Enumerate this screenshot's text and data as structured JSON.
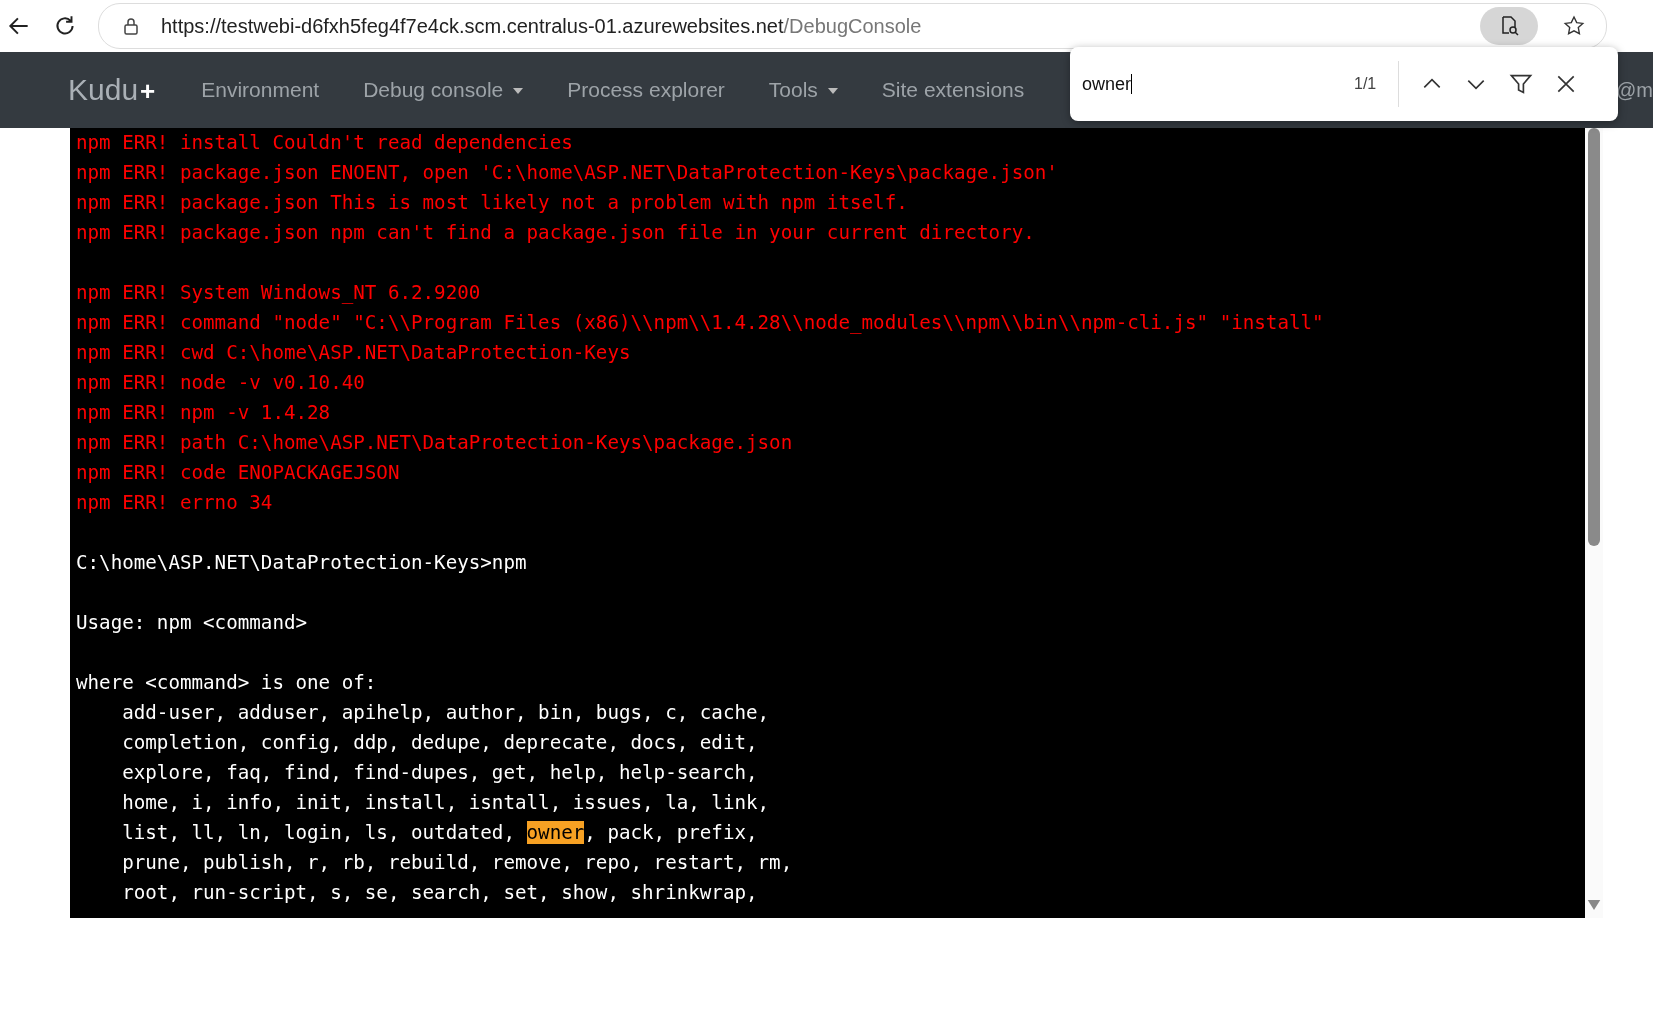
{
  "browser": {
    "url_host": "https://testwebi-d6fxh5feg4f7e4ck.scm.centralus-01.azurewebsites.net",
    "url_path": "/DebugConsole"
  },
  "navbar": {
    "logo": "Kudu",
    "logo_plus": "+",
    "items": [
      {
        "label": "Environment",
        "dropdown": false
      },
      {
        "label": "Debug console",
        "dropdown": true
      },
      {
        "label": "Process explorer",
        "dropdown": false
      },
      {
        "label": "Tools",
        "dropdown": true
      },
      {
        "label": "Site extensions",
        "dropdown": false
      }
    ],
    "user": "@m"
  },
  "find_bar": {
    "value": "owner",
    "count": "1/1"
  },
  "console": {
    "lines": [
      {
        "kind": "error",
        "text": "npm ERR! install Couldn't read dependencies"
      },
      {
        "kind": "error",
        "text": "npm ERR! package.json ENOENT, open 'C:\\home\\ASP.NET\\DataProtection-Keys\\package.json'"
      },
      {
        "kind": "error",
        "text": "npm ERR! package.json This is most likely not a problem with npm itself."
      },
      {
        "kind": "error",
        "text": "npm ERR! package.json npm can't find a package.json file in your current directory."
      },
      {
        "kind": "blank"
      },
      {
        "kind": "error",
        "text": "npm ERR! System Windows_NT 6.2.9200"
      },
      {
        "kind": "error",
        "text": "npm ERR! command \"node\" \"C:\\\\Program Files (x86)\\\\npm\\\\1.4.28\\\\node_modules\\\\npm\\\\bin\\\\npm-cli.js\" \"install\""
      },
      {
        "kind": "error",
        "text": "npm ERR! cwd C:\\home\\ASP.NET\\DataProtection-Keys"
      },
      {
        "kind": "error",
        "text": "npm ERR! node -v v0.10.40"
      },
      {
        "kind": "error",
        "text": "npm ERR! npm -v 1.4.28"
      },
      {
        "kind": "error",
        "text": "npm ERR! path C:\\home\\ASP.NET\\DataProtection-Keys\\package.json"
      },
      {
        "kind": "error",
        "text": "npm ERR! code ENOPACKAGEJSON"
      },
      {
        "kind": "error",
        "text": "npm ERR! errno 34"
      },
      {
        "kind": "blank"
      },
      {
        "kind": "output",
        "text": "C:\\home\\ASP.NET\\DataProtection-Keys>npm"
      },
      {
        "kind": "blank"
      },
      {
        "kind": "output",
        "text": "Usage: npm <command>"
      },
      {
        "kind": "blank"
      },
      {
        "kind": "output",
        "text": "where <command> is one of:"
      },
      {
        "kind": "output",
        "text": "    add-user, adduser, apihelp, author, bin, bugs, c, cache,"
      },
      {
        "kind": "output",
        "text": "    completion, config, ddp, dedupe, deprecate, docs, edit,"
      },
      {
        "kind": "output",
        "text": "    explore, faq, find, find-dupes, get, help, help-search,"
      },
      {
        "kind": "output",
        "text": "    home, i, info, init, install, isntall, issues, la, link,"
      },
      {
        "kind": "match",
        "before": "    list, ll, ln, login, ls, outdated, ",
        "match": "owner",
        "after": ", pack, prefix,"
      },
      {
        "kind": "output",
        "text": "    prune, publish, r, rb, rebuild, remove, repo, restart, rm,"
      },
      {
        "kind": "output",
        "text": "    root, run-script, s, se, search, set, show, shrinkwrap,"
      }
    ]
  }
}
